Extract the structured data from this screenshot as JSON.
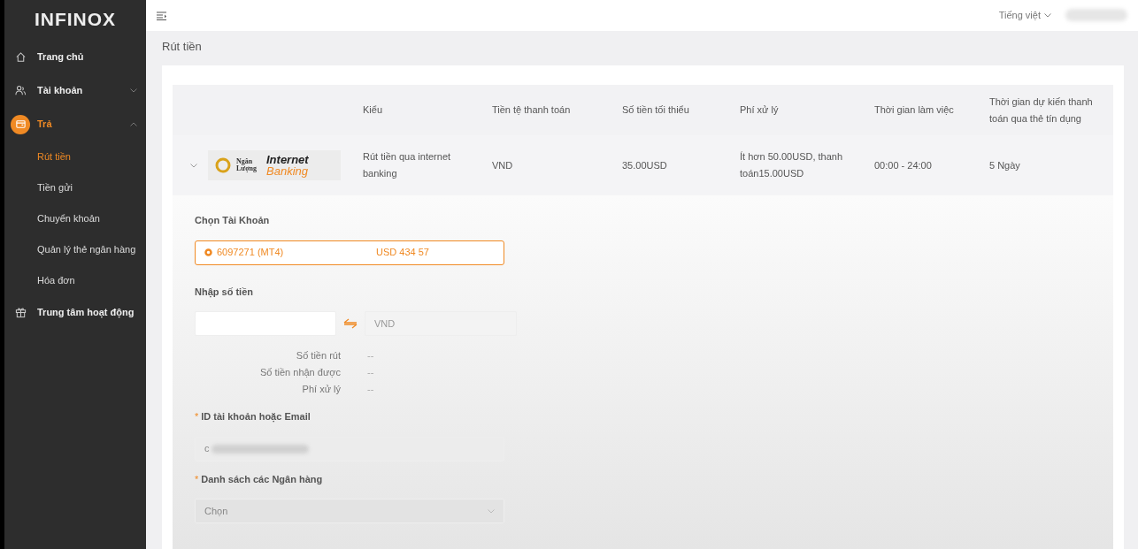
{
  "sidebar": {
    "logo": "INFINOX",
    "items": [
      {
        "label": "Trang chủ",
        "selected": false
      },
      {
        "label": "Tài khoản",
        "selected": false,
        "expanded": false
      },
      {
        "label": "Trả",
        "selected": true,
        "expanded": true,
        "children": [
          {
            "label": "Rút tiền",
            "selected": true
          },
          {
            "label": "Tiền gửi",
            "selected": false
          },
          {
            "label": "Chuyển khoản",
            "selected": false
          },
          {
            "label": "Quản lý thẻ ngân hàng",
            "selected": false
          },
          {
            "label": "Hóa đơn",
            "selected": false
          }
        ]
      },
      {
        "label": "Trung tâm hoạt động",
        "selected": false
      }
    ]
  },
  "topbar": {
    "language": "Tiếng việt"
  },
  "page_title": "Rút tiền",
  "table": {
    "columns": [
      "Kiểu",
      "Tiền tệ thanh toán",
      "Số tiền tối thiểu",
      "Phí xử lý",
      "Thời gian làm việc",
      "Thời gian dự kiến thanh toán qua thẻ tín dụng"
    ],
    "rows": [
      {
        "expanded": true,
        "logo": {
          "brand": "Ngân Lượng",
          "title": "Internet",
          "subtitle": "Banking"
        },
        "cells": [
          "Rút tiền qua internet banking",
          "VND",
          "35.00USD",
          "Ít hơn 50.00USD, thanh toán15.00USD",
          "00:00 - 24:00",
          "5 Ngày"
        ]
      }
    ]
  },
  "form": {
    "account_label": "Chọn Tài Khoản",
    "account": {
      "selected": true,
      "number": "6097271 (MT4)",
      "balance": "USD 434 57"
    },
    "amount_label": "Nhập số tiền",
    "amount_currency": "VND",
    "summary": [
      {
        "label": "Số tiền rút",
        "value": "--"
      },
      {
        "label": "Số tiền nhận được",
        "value": "--"
      },
      {
        "label": "Phí xử lý",
        "value": "--"
      }
    ],
    "id_label": "ID tài khoản hoặc Email",
    "id_required_mark": "*",
    "id_value": "c",
    "bank_label": "Danh sách các Ngân hàng",
    "bank_required_mark": "*",
    "bank_placeholder": "Chọn"
  }
}
